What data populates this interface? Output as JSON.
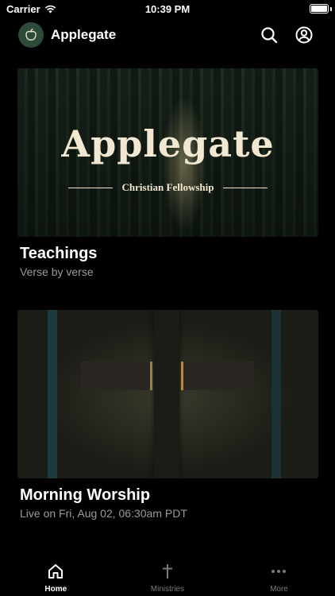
{
  "status_bar": {
    "carrier": "Carrier",
    "time": "10:39 PM"
  },
  "header": {
    "app_title": "Applegate"
  },
  "cards": [
    {
      "banner_title": "Applegate",
      "banner_subtitle": "Christian Fellowship",
      "title": "Teachings",
      "subtitle": "Verse by verse"
    },
    {
      "title": "Morning Worship",
      "subtitle": "Live on Fri, Aug 02, 06:30am PDT"
    }
  ],
  "tabs": [
    {
      "label": "Home",
      "icon": "home-icon",
      "active": true
    },
    {
      "label": "Ministries",
      "icon": "cross-icon",
      "active": false
    },
    {
      "label": "More",
      "icon": "more-icon",
      "active": false
    }
  ],
  "colors": {
    "background": "#000000",
    "subtitle": "#9a9a9a",
    "banner_text": "#f2e8d2",
    "inactive_tab": "#7a7a7a"
  }
}
